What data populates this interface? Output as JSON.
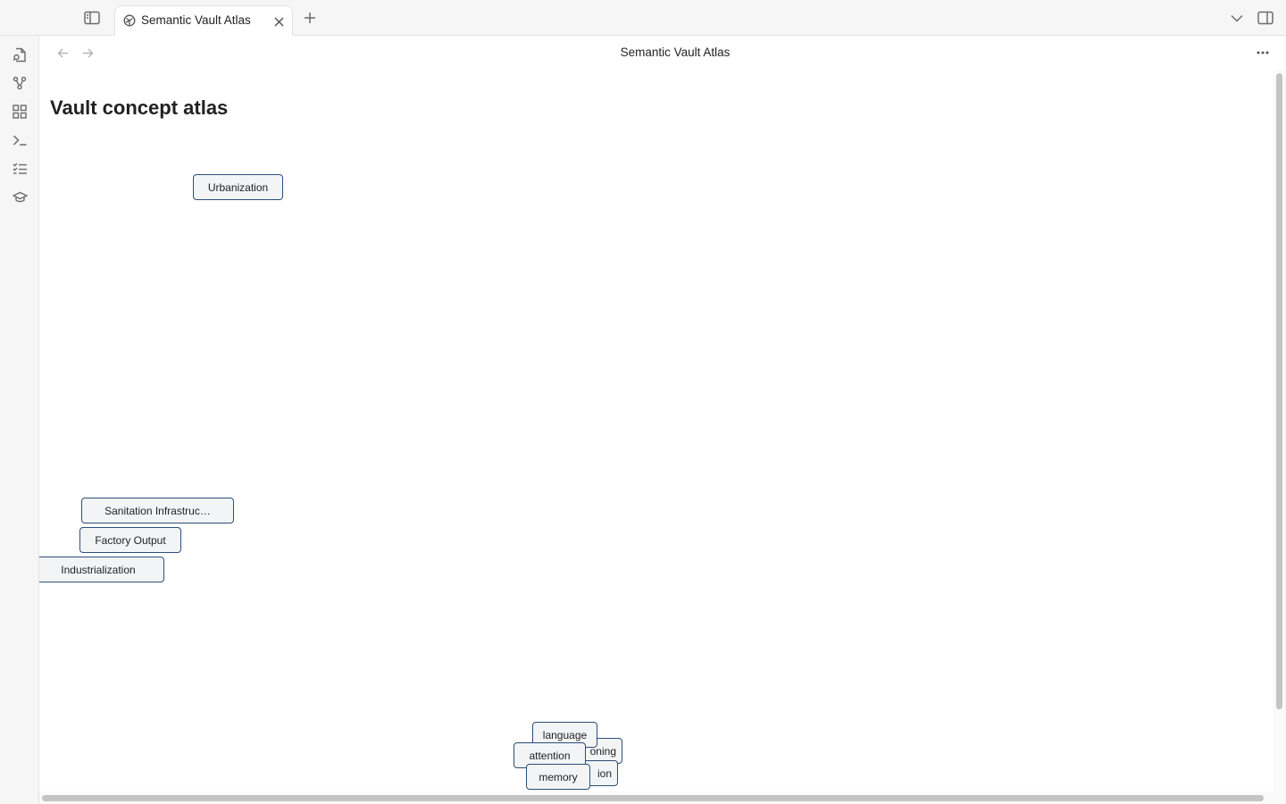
{
  "tab": {
    "title": "Semantic Vault Atlas"
  },
  "view": {
    "title": "Semantic Vault Atlas"
  },
  "page": {
    "heading": "Vault concept atlas"
  },
  "nodes": {
    "urbanization": "Urbanization",
    "sanitation": "Sanitation Infrastruc…",
    "factory_output": "Factory Output",
    "industrialization": "Industrialization",
    "language": "language",
    "reasoning_partial": "oning",
    "perception_partial": "ion",
    "attention": "attention",
    "memory": "memory"
  },
  "colors": {
    "node_border": "#2d4e78",
    "node_fill": "#f3f4f6",
    "chrome_bg": "#f6f6f6"
  },
  "icons": {
    "left_sidebar_toggle": "sidebar-left-icon",
    "tab_icon": "graph-icon",
    "tab_close": "close-icon",
    "new_tab": "plus-icon",
    "tab_list": "chevron-down-icon",
    "right_sidebar_toggle": "sidebar-right-icon",
    "ribbon": [
      "file-search-icon",
      "graph-branch-icon",
      "grid-icon",
      "terminal-icon",
      "list-checks-icon",
      "graduation-cap-icon"
    ],
    "back": "arrow-left-icon",
    "forward": "arrow-right-icon",
    "more": "more-horizontal-icon"
  }
}
